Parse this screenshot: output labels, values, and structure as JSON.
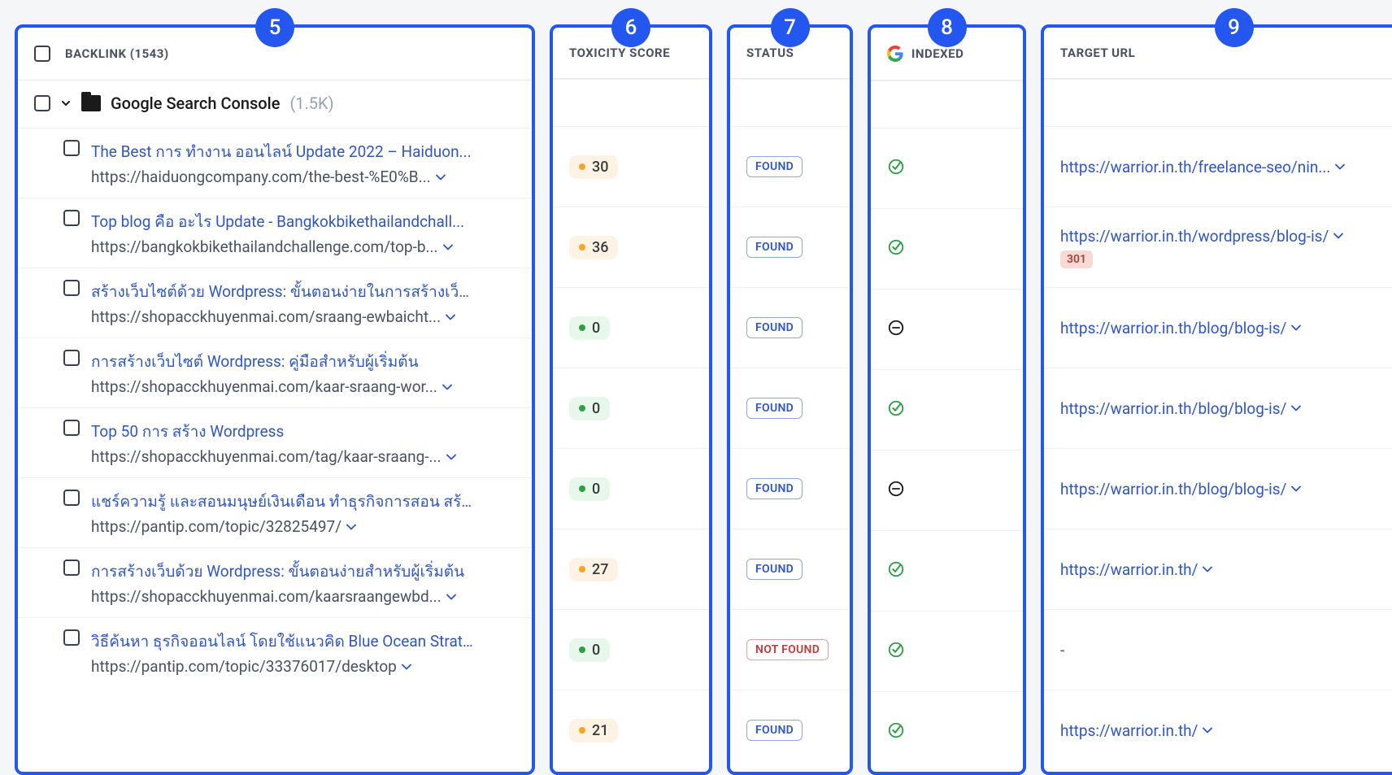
{
  "callouts": {
    "c1": "5",
    "c2": "6",
    "c3": "7",
    "c4": "8",
    "c5": "9"
  },
  "headers": {
    "backlink": "BACKLINK (1543)",
    "toxicity": "TOXICITY SCORE",
    "status": "STATUS",
    "indexed": "INDEXED",
    "target": "TARGET URL"
  },
  "group": {
    "label": "Google Search Console",
    "count": "(1.5K)"
  },
  "rows": [
    {
      "title": "The Best การ ทํางาน ออนไลน์ Update 2022 – Haiduon...",
      "url": "https://haiduongcompany.com/the-best-%E0%B...",
      "toxicity": {
        "value": "30",
        "level": "orange"
      },
      "status": "FOUND",
      "indexed": "yes",
      "target": "https://warrior.in.th/freelance-seo/nin...",
      "http": ""
    },
    {
      "title": "Top blog คือ อะไร Update - Bangkokbikethailandchall...",
      "url": "https://bangkokbikethailandchallenge.com/top-b...",
      "toxicity": {
        "value": "36",
        "level": "orange"
      },
      "status": "FOUND",
      "indexed": "yes",
      "target": "https://warrior.in.th/wordpress/blog-is/",
      "http": "301"
    },
    {
      "title": "สร้างเว็บไซต์ด้วย Wordpress: ขั้นตอนง่ายในการสร้างเว็บ...",
      "url": "https://shopacckhuyenmai.com/sraang-ewbaicht...",
      "toxicity": {
        "value": "0",
        "level": "green"
      },
      "status": "FOUND",
      "indexed": "no",
      "target": "https://warrior.in.th/blog/blog-is/",
      "http": ""
    },
    {
      "title": "การสร้างเว็บไซต์ Wordpress: คู่มือสำหรับผู้เริ่มต้น",
      "url": "https://shopacckhuyenmai.com/kaar-sraang-wor...",
      "toxicity": {
        "value": "0",
        "level": "green"
      },
      "status": "FOUND",
      "indexed": "yes",
      "target": "https://warrior.in.th/blog/blog-is/",
      "http": ""
    },
    {
      "title": "Top 50 การ สร้าง Wordpress",
      "url": "https://shopacckhuyenmai.com/tag/kaar-sraang-...",
      "toxicity": {
        "value": "0",
        "level": "green"
      },
      "status": "FOUND",
      "indexed": "no",
      "target": "https://warrior.in.th/blog/blog-is/",
      "http": ""
    },
    {
      "title": "แชร์ความรู้ และสอนมนุษย์เงินเดือน ทำธุรกิจการสอน สร้างร...",
      "url": "https://pantip.com/topic/32825497/",
      "toxicity": {
        "value": "27",
        "level": "orange"
      },
      "status": "FOUND",
      "indexed": "yes",
      "target": "https://warrior.in.th/",
      "http": ""
    },
    {
      "title": "การสร้างเว็บด้วย Wordpress: ขั้นตอนง่ายสำหรับผู้เริ่มต้น",
      "url": "https://shopacckhuyenmai.com/kaarsraangewbd...",
      "toxicity": {
        "value": "0",
        "level": "green"
      },
      "status": "NOT FOUND",
      "indexed": "yes",
      "target": "-",
      "http": ""
    },
    {
      "title": "วิธีค้นหา ธุรกิจออนไลน์ โดยใช้แนวคิด Blue Ocean Strate...",
      "url": "https://pantip.com/topic/33376017/desktop",
      "toxicity": {
        "value": "21",
        "level": "orange"
      },
      "status": "FOUND",
      "indexed": "yes",
      "target": "https://warrior.in.th/",
      "http": ""
    }
  ]
}
